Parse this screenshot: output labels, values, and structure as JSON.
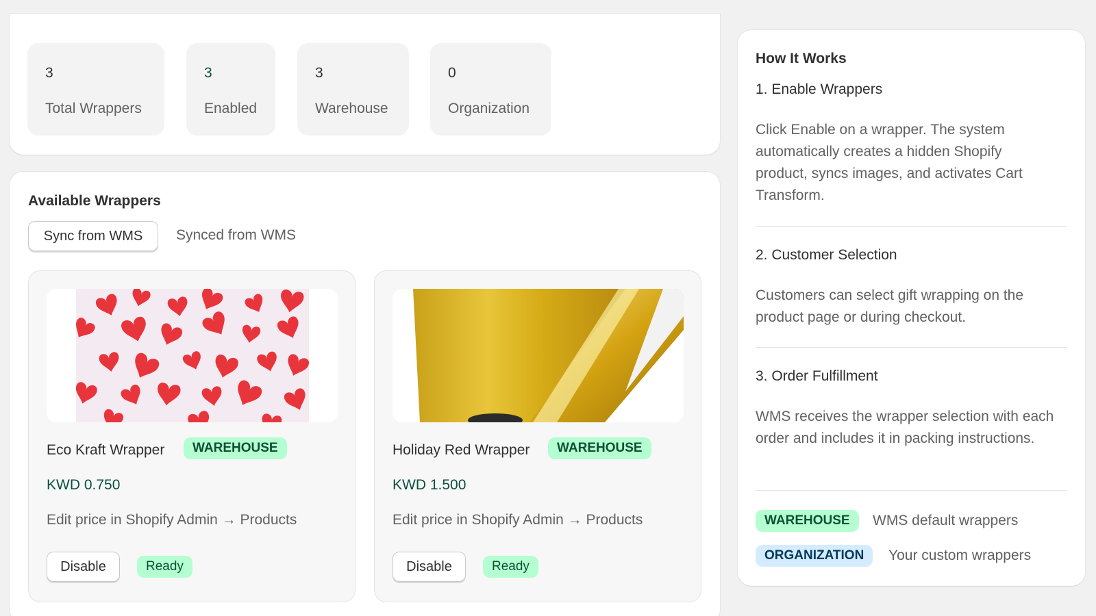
{
  "stats": [
    {
      "value": "3",
      "label": "Total Wrappers"
    },
    {
      "value": "3",
      "label": "Enabled"
    },
    {
      "value": "3",
      "label": "Warehouse"
    },
    {
      "value": "0",
      "label": "Organization"
    }
  ],
  "wrappers_section": {
    "title": "Available Wrappers",
    "sync_button": "Sync from WMS",
    "synced_label": "Synced from WMS",
    "items": [
      {
        "name": "Eco Kraft Wrapper",
        "badge": "WAREHOUSE",
        "price": "KWD 0.750",
        "note": "Edit price in Shopify Admin → Products",
        "disable_label": "Disable",
        "status": "Ready",
        "image": "red-hearts-pattern"
      },
      {
        "name": "Holiday Red Wrapper",
        "badge": "WAREHOUSE",
        "price": "KWD 1.500",
        "note": "Edit price in Shopify Admin → Products",
        "disable_label": "Disable",
        "status": "Ready",
        "image": "gold-foil-roll"
      }
    ]
  },
  "how_it_works": {
    "title": "How It Works",
    "steps": [
      {
        "title": "1. Enable Wrappers",
        "text": "Click Enable on a wrapper. The system automatically creates a hidden Shopify product, syncs images, and activates Cart Transform."
      },
      {
        "title": "2. Customer Selection",
        "text": "Customers can select gift wrapping on the product page or during checkout."
      },
      {
        "title": "3. Order Fulfillment",
        "text": "WMS receives the wrapper selection with each order and includes it in packing instructions."
      }
    ],
    "legend": [
      {
        "badge": "WAREHOUSE",
        "text": "WMS default wrappers"
      },
      {
        "badge": "ORGANIZATION",
        "text": "Your custom wrappers"
      }
    ]
  },
  "colors": {
    "page_bg": "#f1f1f1",
    "warehouse_badge": "#b4fed2",
    "organization_badge": "#d5ebff",
    "price_text": "#0b4f3e"
  }
}
